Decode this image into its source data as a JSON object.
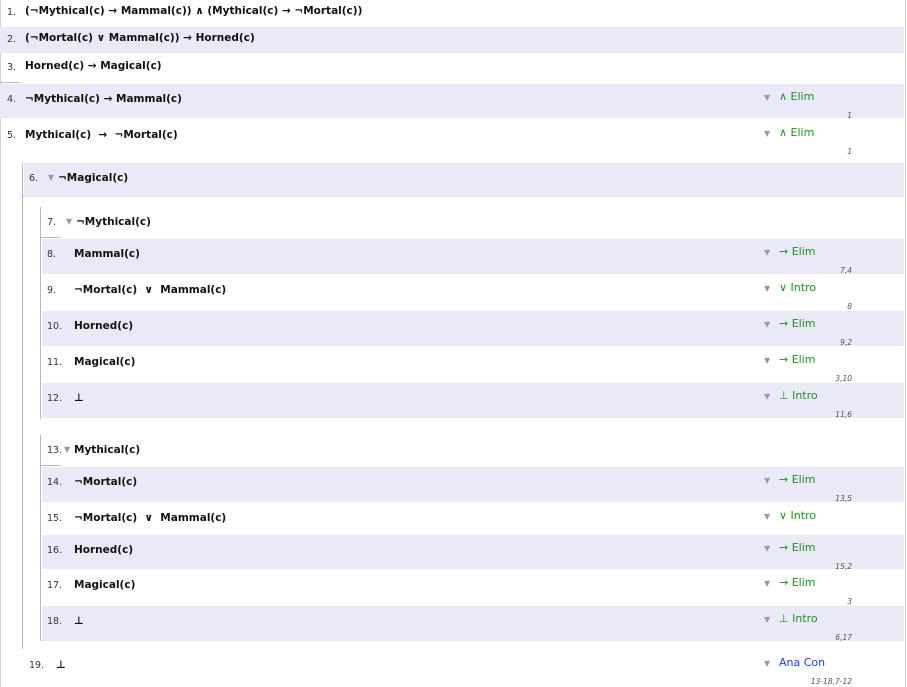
{
  "lines": [
    {
      "num": "1.",
      "formula": "(¬Mythical(c) → Mammal(c)) ∧ (Mythical(c) → ¬Mortal(c))",
      "rule": "",
      "refs": "",
      "depth": 0,
      "subproof_head": false
    },
    {
      "num": "2.",
      "formula": "(¬Mortal(c) ∨ Mammal(c)) → Horned(c)",
      "rule": "",
      "refs": "",
      "depth": 0,
      "subproof_head": false
    },
    {
      "num": "3.",
      "formula": "Horned(c) → Magical(c)",
      "rule": "",
      "refs": "",
      "depth": 0,
      "subproof_head": false
    },
    {
      "num": "4.",
      "formula": "¬Mythical(c) → Mammal(c)",
      "rule": "∧ Elim",
      "refs": "1",
      "depth": 0,
      "subproof_head": false
    },
    {
      "num": "5.",
      "formula": "Mythical(c)  →  ¬Mortal(c)",
      "rule": "∧ Elim",
      "refs": "1",
      "depth": 0,
      "subproof_head": false
    },
    {
      "num": "6.",
      "formula": "¬Magical(c)",
      "rule": "",
      "refs": "",
      "depth": 1,
      "subproof_head": true
    },
    {
      "num": "7.",
      "formula": "¬Mythical(c)",
      "rule": "",
      "refs": "",
      "depth": 2,
      "subproof_head": true
    },
    {
      "num": "8.",
      "formula": "Mammal(c)",
      "rule": "→ Elim",
      "refs": "7,4",
      "depth": 2,
      "subproof_head": false
    },
    {
      "num": "9.",
      "formula": "¬Mortal(c)  ∨  Mammal(c)",
      "rule": "∨ Intro",
      "refs": "8",
      "depth": 2,
      "subproof_head": false
    },
    {
      "num": "10.",
      "formula": "Horned(c)",
      "rule": "→ Elim",
      "refs": "9,2",
      "depth": 2,
      "subproof_head": false
    },
    {
      "num": "11.",
      "formula": "Magical(c)",
      "rule": "→ Elim",
      "refs": "3,10",
      "depth": 2,
      "subproof_head": false
    },
    {
      "num": "12.",
      "formula": "⊥",
      "rule": "⊥ Intro",
      "refs": "11,6",
      "depth": 2,
      "subproof_head": false
    },
    {
      "num": "13.",
      "formula": "Mythical(c)",
      "rule": "",
      "refs": "",
      "depth": 2,
      "subproof_head": true
    },
    {
      "num": "14.",
      "formula": "¬Mortal(c)",
      "rule": "→ Elim",
      "refs": "13,5",
      "depth": 2,
      "subproof_head": false
    },
    {
      "num": "15.",
      "formula": "¬Mortal(c)  ∨  Mammal(c)",
      "rule": "∨ Intro",
      "refs": "",
      "depth": 2,
      "subproof_head": false
    },
    {
      "num": "16.",
      "formula": "Horned(c)",
      "rule": "→ Elim",
      "refs": "15,2",
      "depth": 2,
      "subproof_head": false
    },
    {
      "num": "17.",
      "formula": "Magical(c)",
      "rule": "→ Elim",
      "refs": "3",
      "depth": 2,
      "subproof_head": false
    },
    {
      "num": "18.",
      "formula": "⊥",
      "rule": "⊥ Intro",
      "refs": "6,17",
      "depth": 2,
      "subproof_head": false
    },
    {
      "num": "19.",
      "formula": "⊥",
      "rule": "Ana Con",
      "refs": "13-18,7-12",
      "depth": 1,
      "subproof_head": false
    }
  ],
  "colors": {
    "shade": "#e9e9f8",
    "rule_green": "#1f8f1f",
    "rule_blue": "#1c3fd6",
    "bar": "#b8b8c4"
  },
  "icons": {
    "row_caret": "caret-down-icon",
    "rule_caret": "caret-down-icon"
  }
}
